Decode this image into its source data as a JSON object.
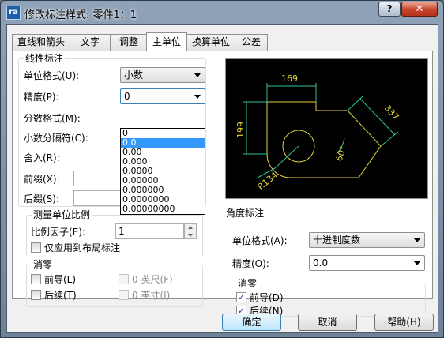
{
  "window": {
    "title": "修改标注样式: 零件1：1",
    "app_icon_text": "ra",
    "help_label": "?",
    "close_label": "✕"
  },
  "tabs": [
    {
      "label": "直线和箭头"
    },
    {
      "label": "文字"
    },
    {
      "label": "调整"
    },
    {
      "label": "主单位"
    },
    {
      "label": "换算单位"
    },
    {
      "label": "公差"
    }
  ],
  "linear": {
    "title": "线性标注",
    "unit_format_label": "单位格式(U):",
    "unit_format_value": "小数",
    "precision_label": "精度(P):",
    "precision_value": "0",
    "fraction_label": "分数格式(M):",
    "decimal_sep_label": "小数分隔符(C):",
    "round_label": "舍入(R):",
    "prefix_label": "前缀(X):",
    "suffix_label": "后缀(S):",
    "precision_options": [
      "0",
      "0.0",
      "0.00",
      "0.000",
      "0.0000",
      "0.00000",
      "0.000000",
      "0.0000000",
      "0.00000000"
    ],
    "precision_selected_index": 1
  },
  "scale": {
    "title": "测量单位比例",
    "factor_label": "比例因子(E):",
    "factor_value": "1",
    "layout_only_label": "仅应用到布局标注"
  },
  "zero_left": {
    "title": "消零",
    "leading_label": "前导(L)",
    "trailing_label": "后续(T)",
    "feet_label": "0 英尺(F)",
    "inches_label": "0 英寸(I)"
  },
  "preview": {
    "dim_top": "169",
    "dim_left": "199",
    "dim_right": "337",
    "angle": "60°",
    "radius": "R134",
    "line_color": "#e2d23c",
    "dim_color": "#2fc49a"
  },
  "angular": {
    "title": "角度标注",
    "unit_format_label": "单位格式(A):",
    "unit_format_value": "十进制度数",
    "precision_label": "精度(O):",
    "precision_value": "0.0"
  },
  "zero_right": {
    "title": "消零",
    "leading_label": "前导(D)",
    "leading_checked": true,
    "trailing_label": "后续(N)",
    "trailing_checked": true
  },
  "buttons": {
    "ok": "确定",
    "cancel": "取消",
    "help": "帮助(H)"
  }
}
